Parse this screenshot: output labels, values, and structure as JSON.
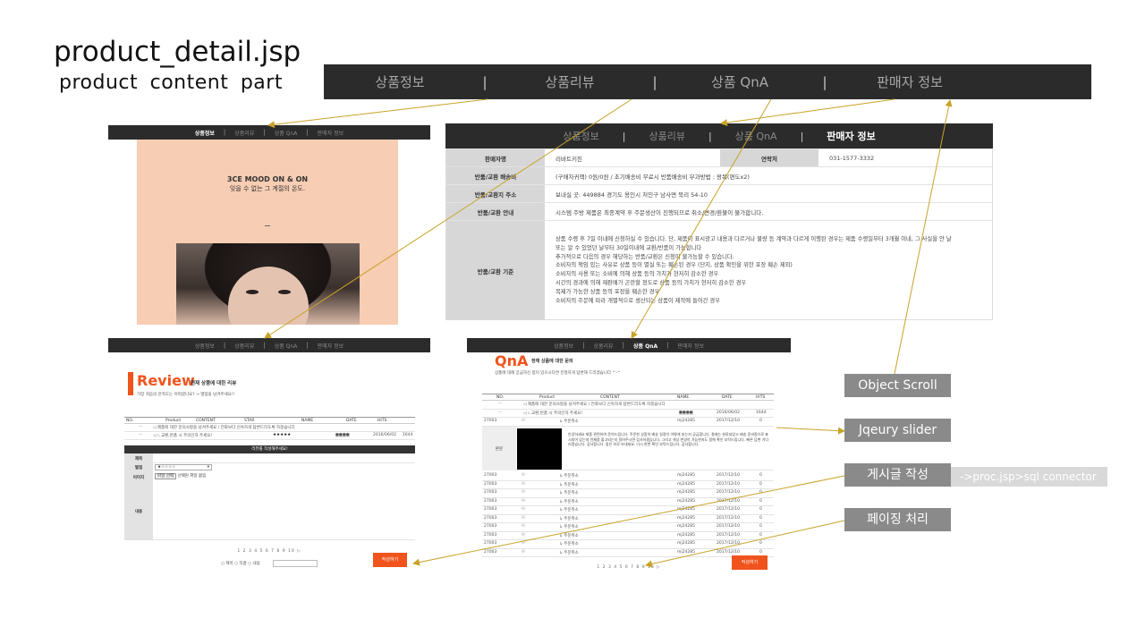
{
  "page": {
    "title": "product_detail.jsp",
    "subtitle": "product  content  part"
  },
  "main_tabs": [
    {
      "label": "상품정보"
    },
    {
      "label": "상품리뷰"
    },
    {
      "label": "상품 QnA"
    },
    {
      "label": "판매자 정보"
    }
  ],
  "tab_separator": "|",
  "product_info_panel": {
    "tabs": [
      "상품정보",
      "상품리뷰",
      "상품 QnA",
      "판매자 정보"
    ],
    "heading": "3CE MOOD ON & ON",
    "subheading": "잊을 수 없는 그 계절의 온도."
  },
  "seller_panel": {
    "tabs": [
      "상품정보",
      "상품리뷰",
      "상품 QnA",
      "판매자 정보"
    ],
    "seller_name_label": "판매자명",
    "seller_name": "리바트키친",
    "contact_label": "연락처",
    "contact": "031-1577-3332",
    "return_fee_label": "반품/교환 배송비",
    "return_fee": "(구매자귀책) 0원/0원 / 초기배송비 무료시 반품배송비 부과방법 : 왕복(편도x2)",
    "return_addr_label": "반품/교환지 주소",
    "return_addr": "보내실 곳: 449884 경기도 용인시 처인구 남사면 북리 54-10",
    "return_guide_label": "반품/교환 안내",
    "return_guide": "시스템 주방 제품은 최종계약 후 주문생산이 진행되므로 취소/변경/환불이 불가합니다.",
    "return_criteria_label": "반품/교환 기준",
    "return_criteria": [
      "상품 수령 후 7일 이내에 신청하실 수 있습니다. 단, 제품이 표시광고 내용과 다르거나 불량 등 계약과 다르게 이행된 경우는 제품 수령일부터 3개월 이내, 그 사실을 안 날",
      "또는 알 수 있었던 날부터 30일이내에 교환/반품이 가능합니다",
      "추가적으로 다음의 경우 해당하는 반품/교환은 신청이 불가능할 수 있습니다.",
      "소비자의 책임 있는 사유로 상품 등이 멸실 또는 훼손된 경우 (단지, 상품 확인을 위한 포장 훼손 제외)",
      "소비자의 사용 또는 소비에 의해 상품 등의 가치가 현저히 감소한 경우",
      "시간의 경과에 의해 재판매가 곤란할 정도로 상품 등의 가치가 현저히 감소한 경우",
      "복제가 가능한 상품 등의 포장을 훼손한 경우",
      "소비자의 주문에 따라 개별적으로 생산되는 상품이 제작에 들어간 경우"
    ]
  },
  "review_panel": {
    "tabs": [
      "상품정보",
      "상품리뷰",
      "상품 QnA",
      "판매자 정보"
    ],
    "title": "Review",
    "subtitle": "현재 상품에 대한 리뷰",
    "desc": "가장 처음의 만족도는 어떠셨나요? → 별점을 남겨주세요!!",
    "columns": [
      "NO.",
      "Product",
      "CONTENT",
      "STAR",
      "NAME",
      "DATE",
      "HITS"
    ],
    "rows": [
      {
        "no": "···",
        "content": "◁  제품에 대한 문의사항을 남겨주세요 / 전화보다 신속하게 답변드리도록 하겠습니다",
        "star": "",
        "name": "",
        "date": "",
        "hits": ""
      },
      {
        "no": "···",
        "content": "◁  ㄴ교환,반품 시 주의인하 주세요!",
        "star": "★★★★★",
        "name": "●●●●",
        "date": "2016/06/02",
        "hits": "1644"
      }
    ],
    "form_header": "리뷰를 작성해주세요!",
    "form_title_label": "제목",
    "form_star_label": "별점",
    "form_star_value": "★☆☆☆☆",
    "form_file_label": "이미지",
    "form_file_button": "파일 선택",
    "form_file_status": "선택된 파일 없음",
    "form_content_label": "내용",
    "pager": "1 2 3 4 5 6 7 8 9 10 ▷",
    "search_opts": "○ 제목   ○ 작품   ○ 내용",
    "write_button": "작성하기"
  },
  "qna_panel": {
    "tabs": [
      "상품정보",
      "상품리뷰",
      "상품 QnA",
      "판매자 정보"
    ],
    "title": "QnA",
    "subtitle": "현재 상품에 대한 문의",
    "desc": "상품에 대해 궁금하신 점이 있으시다면 친절하게 답변해 드리겠습니다 ^-^",
    "columns": [
      "NO.",
      "Product",
      "CONTENT",
      "NAME",
      "DATE",
      "HITS"
    ],
    "top_rows": [
      {
        "no": "···",
        "content": "◁  제품에 대한 문의사항을 남겨주세요 / 전화보다 신속하게 답변드리도록 하겠습니다",
        "name": "",
        "date": "",
        "hits": ""
      },
      {
        "no": "···",
        "content": "◁  ㄴ교환,반품 시 주의인하 주세요!",
        "name": "●●●●",
        "date": "2016/06/02",
        "hits": "1644"
      },
      {
        "no": "27003",
        "content": "↳ 주문취소",
        "name": "mj24285",
        "date": "2017/12/10",
        "hits": "0"
      }
    ],
    "content_label": "본문",
    "content_text": "안녕하세요 제품 관련하여 문의드립니다. 주문한 상품의 배송 일정이 어떻게 되는지 궁금합니다. 결제는 완료되었고 배송 준비중으로 표시되어 있는데 언제쯤 출고되는지 알려주시면 감사하겠습니다. 그리고 색상 변경이 가능한지도 함께 확인 부탁드립니다. 빠른 답변 기다리겠습니다. 감사합니다. 좋은 하루 보내세요. 다시 한번 확인 부탁드립니다. 감사합니다.",
    "rows": [
      {
        "no": "27003",
        "content": "↳ 주문취소",
        "name": "mj24285",
        "date": "2017/12/10",
        "hits": "0"
      },
      {
        "no": "27003",
        "content": "↳ 주문취소",
        "name": "mj24285",
        "date": "2017/12/10",
        "hits": "0"
      },
      {
        "no": "27003",
        "content": "↳ 주문취소",
        "name": "mj24285",
        "date": "2017/12/10",
        "hits": "0"
      },
      {
        "no": "27003",
        "content": "↳ 주문취소",
        "name": "mj24285",
        "date": "2017/12/10",
        "hits": "0"
      },
      {
        "no": "27003",
        "content": "↳ 주문취소",
        "name": "mj24285",
        "date": "2017/12/10",
        "hits": "0"
      },
      {
        "no": "27003",
        "content": "↳ 주문취소",
        "name": "mj24285",
        "date": "2017/12/10",
        "hits": "0"
      },
      {
        "no": "27003",
        "content": "↳ 주문취소",
        "name": "mj24285",
        "date": "2017/12/10",
        "hits": "0"
      },
      {
        "no": "27003",
        "content": "↳ 주문취소",
        "name": "mj24285",
        "date": "2017/12/10",
        "hits": "0"
      },
      {
        "no": "27003",
        "content": "↳ 주문취소",
        "name": "mj24285",
        "date": "2017/12/10",
        "hits": "0"
      },
      {
        "no": "27003",
        "content": "↳ 주문취소",
        "name": "mj24285",
        "date": "2017/12/10",
        "hits": "0"
      }
    ],
    "pager": "1 2 3 4 5 6 7 8 9 10 ▷",
    "write_button": "작성하기"
  },
  "annotations": {
    "object_scroll": "Object Scroll",
    "jquery_slider": "Jqeury slider",
    "post_write": "게시글 작성",
    "connector": "->proc.jsp>sql connector",
    "paging": "페이징 처리"
  },
  "colors": {
    "accent": "#f0531c",
    "dark_bar": "#2b2b2b",
    "annotation_box": "#8a8a8a",
    "arrow": "#c9a227",
    "peach": "#f7cdb3"
  }
}
